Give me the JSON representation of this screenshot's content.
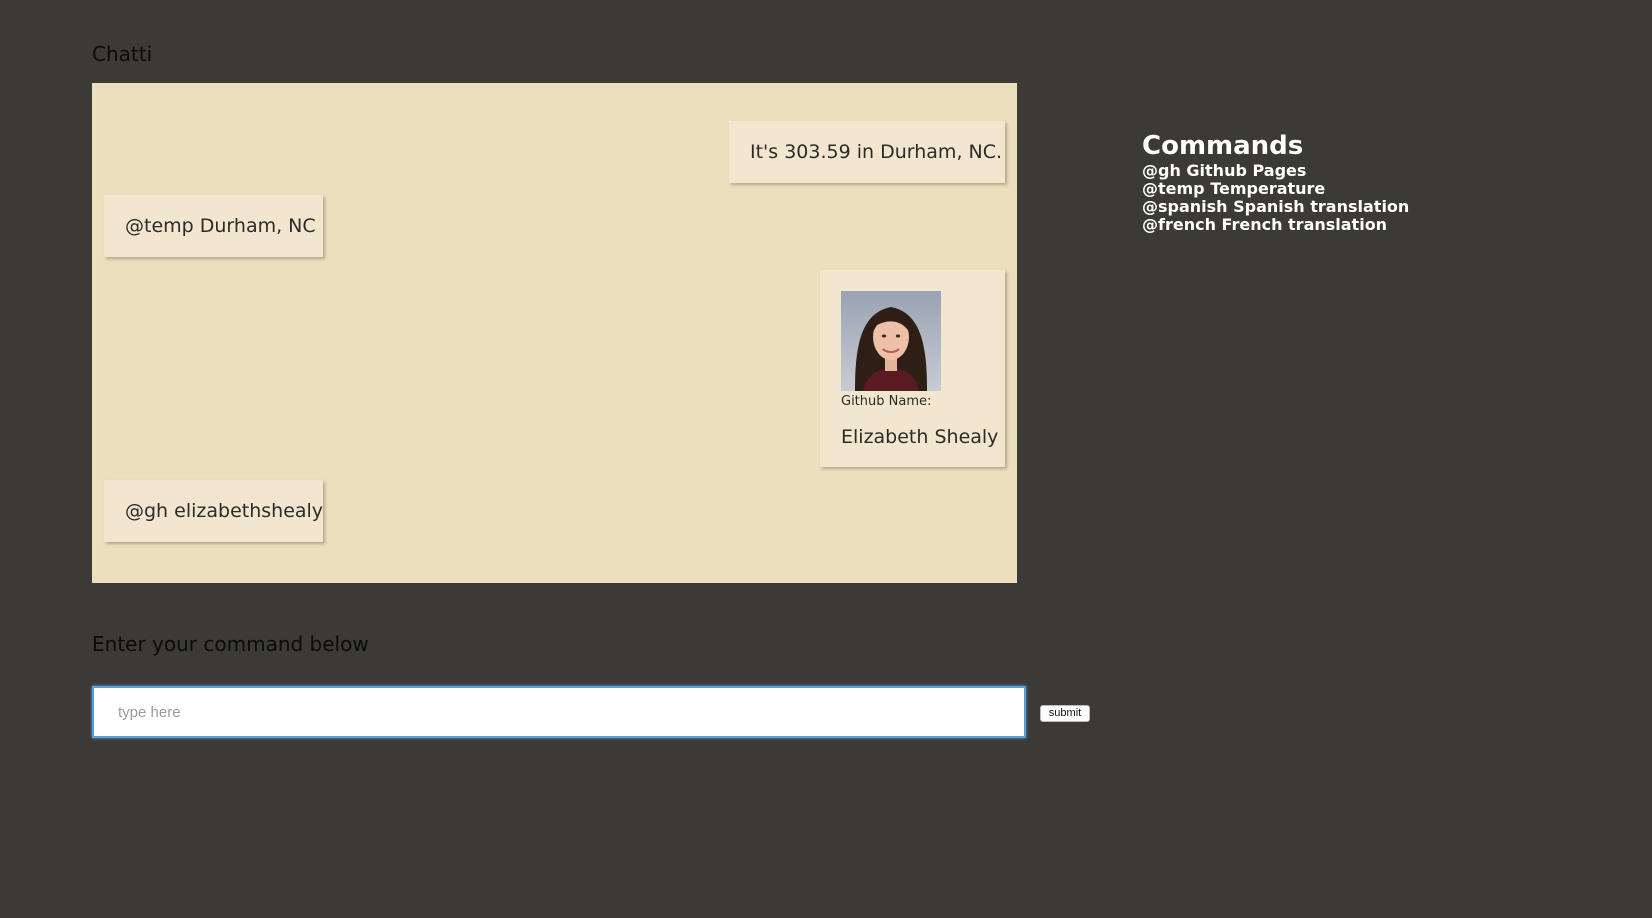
{
  "app": {
    "title": "Chatti"
  },
  "chat": {
    "messages": [
      {
        "side": "right",
        "text": "It's 303.59 in Durham, NC."
      },
      {
        "side": "left",
        "text": "@temp Durham, NC"
      },
      {
        "side": "right",
        "type": "github-card",
        "label": "Github Name:",
        "name": "Elizabeth Shealy"
      },
      {
        "side": "left",
        "text": "@gh elizabethshealy"
      }
    ]
  },
  "commands": {
    "heading": "Commands",
    "items": [
      "@gh Github Pages",
      "@temp Temperature",
      "@spanish Spanish translation",
      "@french French translation"
    ]
  },
  "input": {
    "label": "Enter your command below",
    "placeholder": "type here",
    "value": "",
    "submit_label": "submit"
  },
  "colors": {
    "background": "#3b3a36",
    "chat_background": "#ecdfbd",
    "bubble": "#f3e6cf",
    "input_focus": "#5b9dd9"
  }
}
